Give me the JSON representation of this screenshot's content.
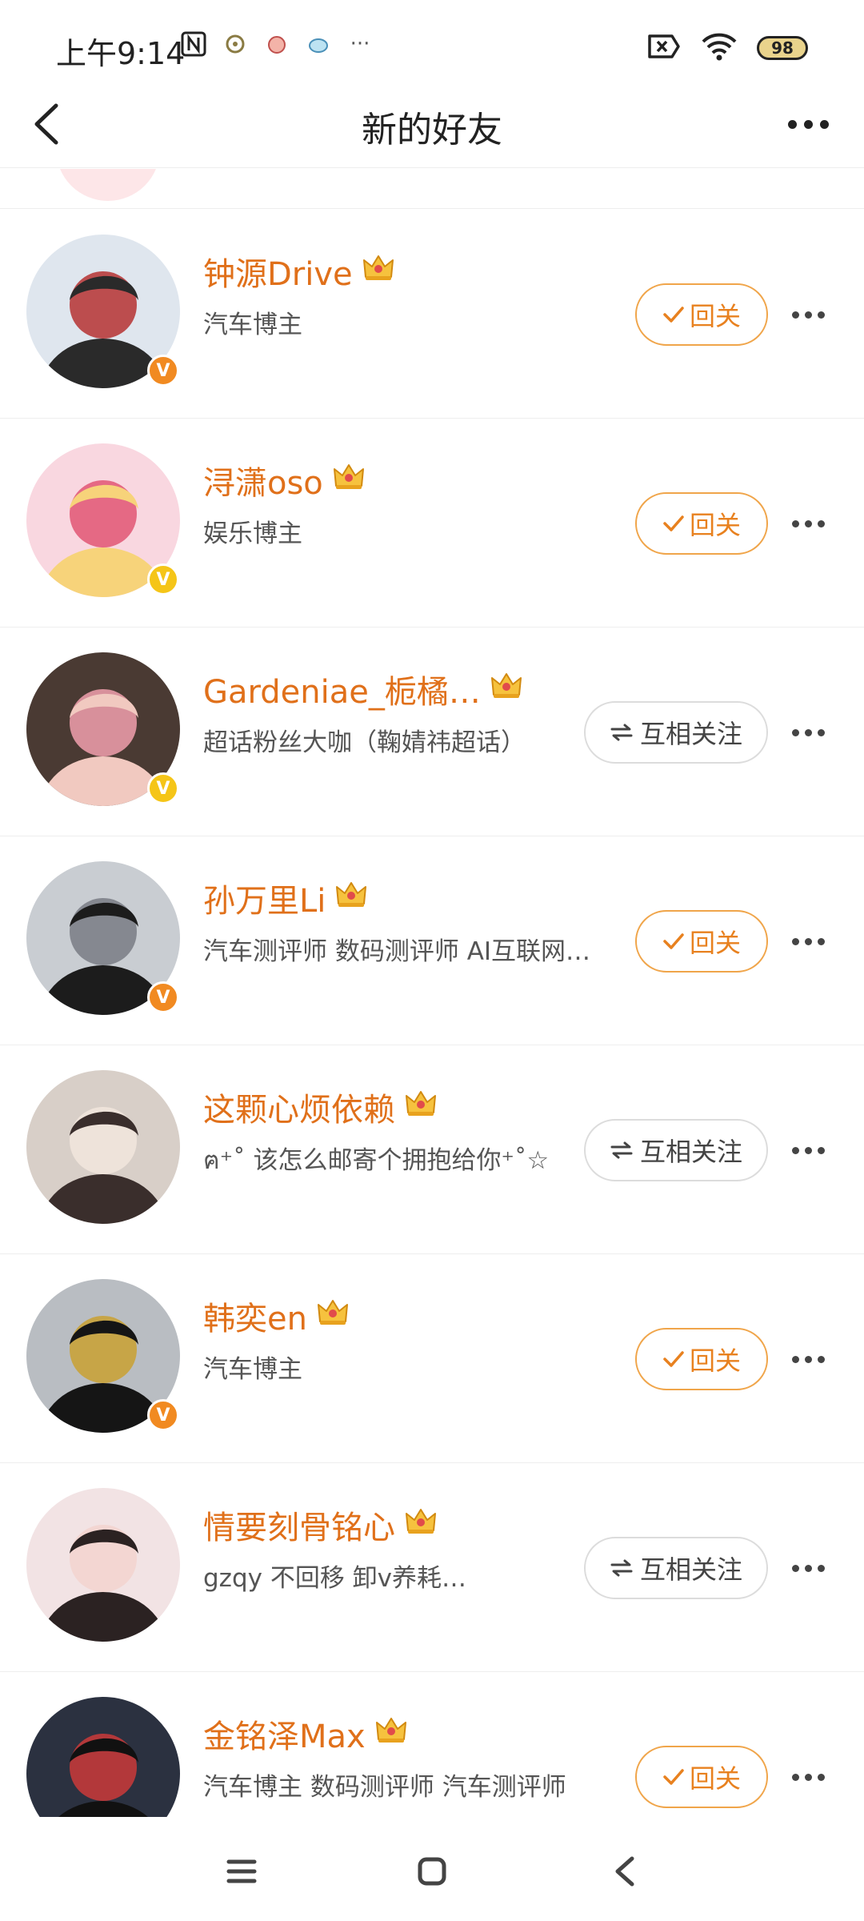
{
  "status": {
    "time": "上午9:14",
    "battery": "98",
    "more": "···"
  },
  "nav": {
    "title": "新的好友"
  },
  "users": [
    {
      "name": "钟源Drive",
      "desc": "汽车博主",
      "action": "回关",
      "action_type": "follow",
      "verified": "orange",
      "avatar_colors": [
        "#dfe6ee",
        "#2a2a2a",
        "#b83c3c"
      ]
    },
    {
      "name": "浔潇oso",
      "desc": "娱乐博主",
      "action": "回关",
      "action_type": "follow",
      "verified": "gold",
      "avatar_colors": [
        "#f9d7e0",
        "#f7d37a",
        "#e25d7a"
      ]
    },
    {
      "name": "Gardeniae_栀橘…",
      "desc": "超话粉丝大咖（鞠婧祎超话）",
      "action": "互相关注",
      "action_type": "mutual",
      "verified": "gold",
      "avatar_colors": [
        "#4a3a33",
        "#f1c9c0",
        "#e89aa6"
      ]
    },
    {
      "name": "孙万里Li",
      "desc": "汽车测评师 数码测评师 AI互联网…",
      "action": "回关",
      "action_type": "follow",
      "verified": "orange",
      "avatar_colors": [
        "#c9cdd2",
        "#1c1c1c",
        "#7d8188"
      ]
    },
    {
      "name": "这颗心烦依赖",
      "desc": "ฅ⁺˚ 该怎么邮寄个拥抱给你⁺˚☆",
      "action": "互相关注",
      "action_type": "mutual",
      "verified": "",
      "avatar_colors": [
        "#d8cfc8",
        "#3a2e2c",
        "#f1e4dc"
      ]
    },
    {
      "name": "韩奕en",
      "desc": "汽车博主",
      "action": "回关",
      "action_type": "follow",
      "verified": "orange",
      "avatar_colors": [
        "#b9bdc2",
        "#151515",
        "#c9a23a"
      ]
    },
    {
      "name": "情要刻骨铭心",
      "desc": "gzqy 不回移 卸v养耗…",
      "action": "互相关注",
      "action_type": "mutual",
      "verified": "",
      "avatar_colors": [
        "#f2e3e4",
        "#2b2222",
        "#f3d4cf"
      ]
    },
    {
      "name": "金铭泽Max",
      "desc": "汽车博主 数码测评师 汽车测评师",
      "action": "回关",
      "action_type": "follow",
      "verified": "",
      "avatar_colors": [
        "#2b3140",
        "#111111",
        "#c23a3a"
      ]
    }
  ],
  "icons": {
    "back": "chevron-left-icon",
    "more": "more-horizontal-icon",
    "check": "check-icon",
    "swap": "swap-arrows-icon",
    "crown": "crown-icon"
  },
  "colors": {
    "accent": "#e0701a",
    "follow_border": "#f0a54a"
  }
}
